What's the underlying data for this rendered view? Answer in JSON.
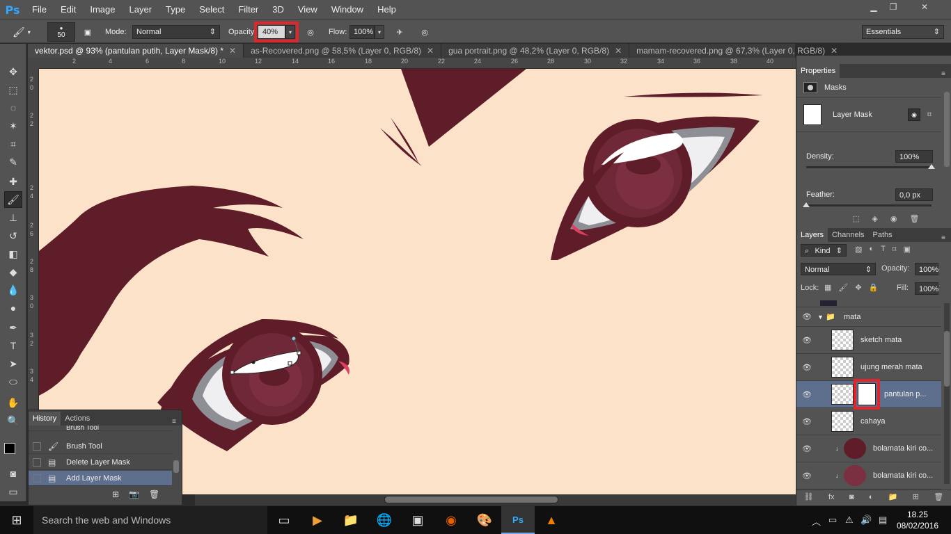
{
  "app": {
    "logo": "Ps"
  },
  "menu": [
    "File",
    "Edit",
    "Image",
    "Layer",
    "Type",
    "Select",
    "Filter",
    "3D",
    "View",
    "Window",
    "Help"
  ],
  "window_controls": {
    "minimize": "▁",
    "restore": "❐",
    "close": "✕"
  },
  "options": {
    "brush_size": "50",
    "mode_label": "Mode:",
    "mode_value": "Normal",
    "opacity_label": "Opacity:",
    "opacity_value": "40%",
    "flow_label": "Flow:",
    "flow_value": "100%",
    "workspace": "Essentials"
  },
  "tabs": [
    {
      "label": "vektor.psd @ 93% (pantulan putih, Layer Mask/8) *"
    },
    {
      "label": "as-Recovered.png @ 58,5% (Layer 0, RGB/8)"
    },
    {
      "label": "gua portrait.png @ 48,2% (Layer 0, RGB/8)"
    },
    {
      "label": "mamam-recovered.png @ 67,3% (Layer 0, RGB/8)"
    }
  ],
  "ruler_h": [
    "2",
    "4",
    "6",
    "8",
    "10",
    "12",
    "14",
    "16",
    "18",
    "20",
    "22",
    "24",
    "26",
    "28",
    "30",
    "32",
    "34",
    "36",
    "38",
    "40"
  ],
  "ruler_v": [
    "2",
    "0",
    "2",
    "2",
    "2",
    "4",
    "2",
    "6",
    "2",
    "8",
    "3",
    "0",
    "3",
    "2",
    "3",
    "4"
  ],
  "history": {
    "tabs": [
      "History",
      "Actions"
    ],
    "rows": [
      {
        "label": "Brush Tool"
      },
      {
        "label": "Brush Tool"
      },
      {
        "label": "Delete Layer Mask"
      },
      {
        "label": "Add Layer Mask"
      }
    ]
  },
  "properties": {
    "tab": "Properties",
    "section": "Masks",
    "mask_label": "Layer Mask",
    "density_label": "Density:",
    "density_value": "100%",
    "feather_label": "Feather:",
    "feather_value": "0,0 px",
    "density": 1.0,
    "feather": 0.0
  },
  "layers": {
    "tabs": [
      "Layers",
      "Channels",
      "Paths"
    ],
    "kind": "Kind",
    "blend": "Normal",
    "opacity_label": "Opacity:",
    "opacity_value": "100%",
    "lock_label": "Lock:",
    "fill_label": "Fill:",
    "fill_value": "100%",
    "group": "mata",
    "items": [
      {
        "name": "sketch mata"
      },
      {
        "name": "ujung merah mata"
      },
      {
        "name": "pantulan p..."
      },
      {
        "name": "cahaya"
      },
      {
        "name": "bolamata kiri co..."
      },
      {
        "name": "bolamata kiri co..."
      }
    ]
  },
  "taskbar": {
    "search": "Search the web and Windows",
    "time": "18.25",
    "date": "08/02/2016"
  }
}
